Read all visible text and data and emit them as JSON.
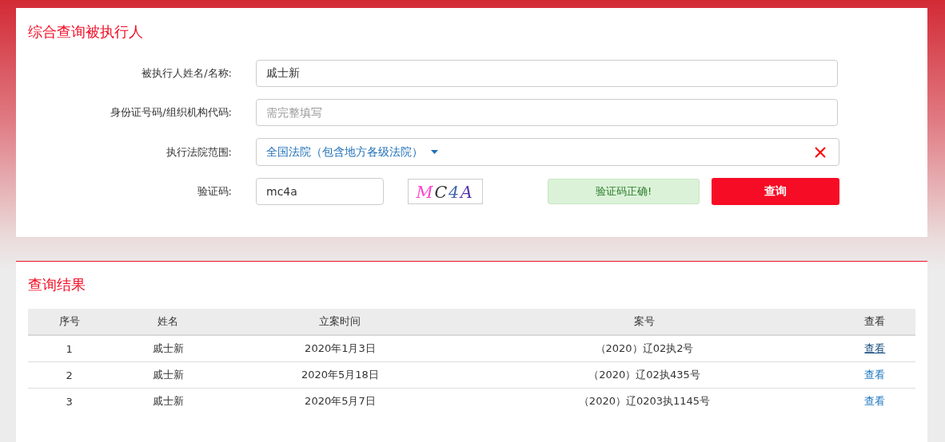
{
  "search_panel": {
    "title": "综合查询被执行人",
    "fields": [
      {
        "kind": "text",
        "label": "被执行人姓名/名称:",
        "value": "戚士新"
      },
      {
        "kind": "text",
        "label": "身份证号码/组织机构代码:",
        "placeholder": "需完整填写"
      },
      {
        "kind": "select",
        "label": "执行法院范围:",
        "value": "全国法院（包含地方各级法院）"
      }
    ],
    "captcha": {
      "label": "验证码:",
      "value": "mc4a",
      "image_text": "MC4A",
      "status": "验证码正确!",
      "valid": true
    },
    "search_button": "查询"
  },
  "results": {
    "title": "查询结果",
    "table": {
      "columns": [
        "序号",
        "姓名",
        "立案时间",
        "案号",
        "查看"
      ],
      "rows": [
        {
          "cells": [
            "1",
            "戚士新",
            "2020年1月3日",
            "（2020）辽02执2号"
          ],
          "link": "查看",
          "hovered": true
        },
        {
          "cells": [
            "2",
            "戚士新",
            "2020年5月18日",
            "（2020）辽02执435号"
          ],
          "link": "查看",
          "hovered": false
        },
        {
          "cells": [
            "3",
            "戚士新",
            "2020年5月7日",
            "（2020）辽0203执1145号"
          ],
          "link": "查看",
          "hovered": false
        }
      ]
    }
  }
}
